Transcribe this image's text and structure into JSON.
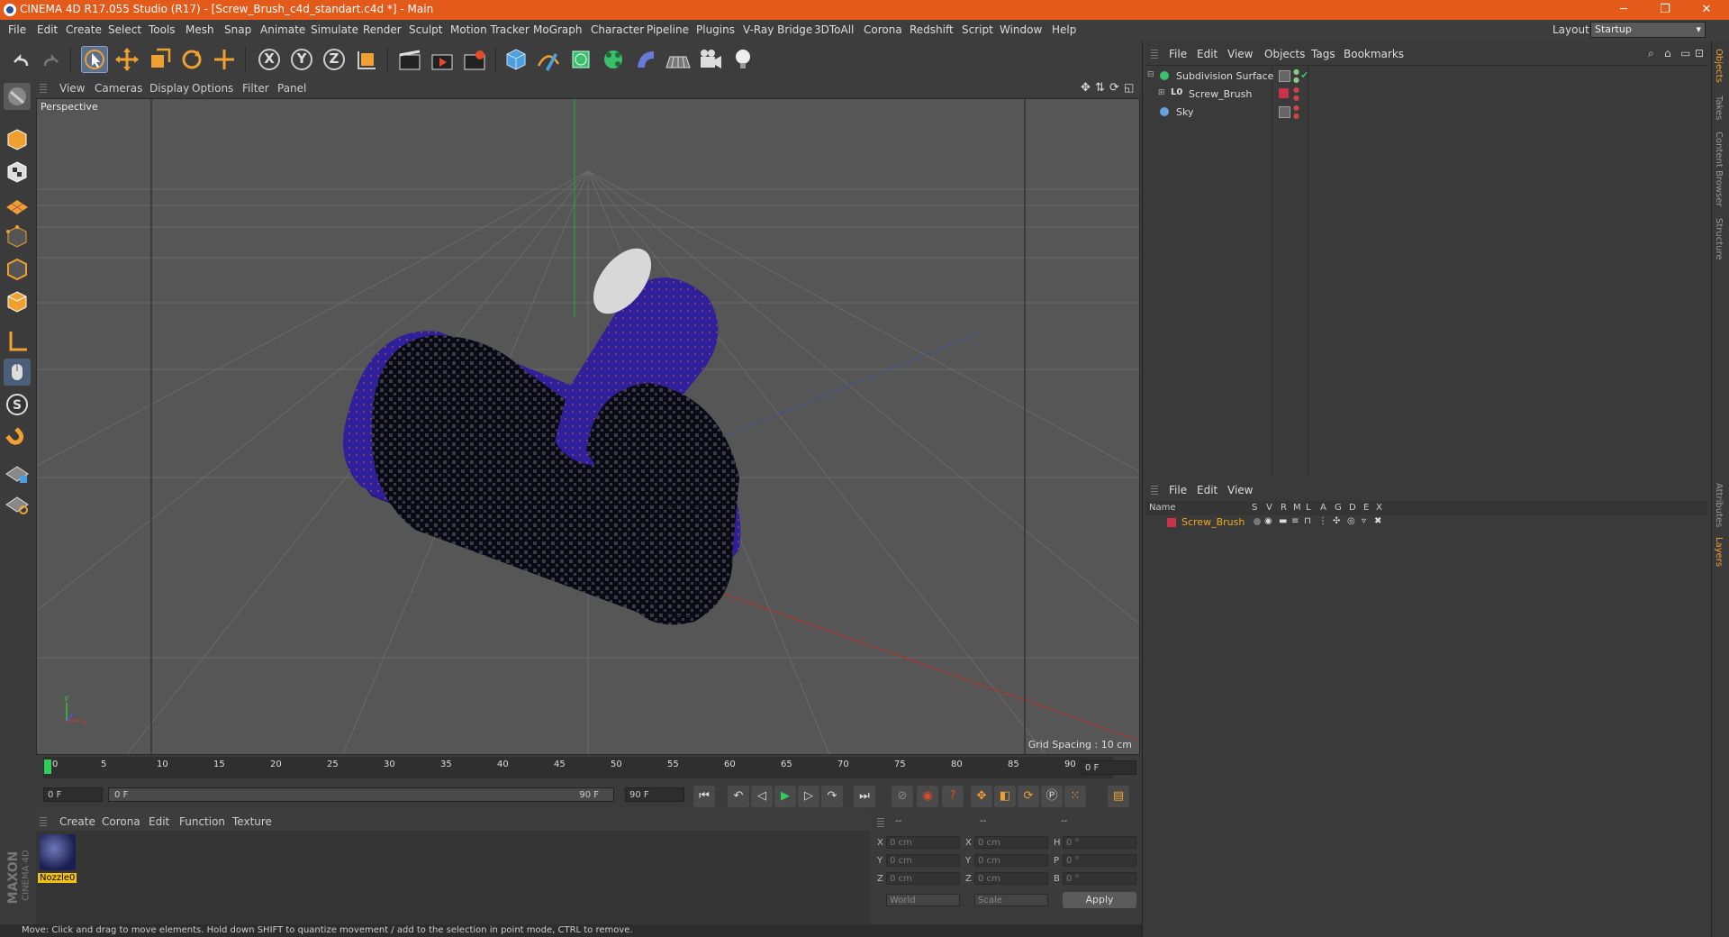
{
  "window": {
    "title": "CINEMA 4D R17.055 Studio (R17) - [Screw_Brush_c4d_standart.c4d *] - Main",
    "minimize": "─",
    "maximize": "❐",
    "close": "✕"
  },
  "menubar": {
    "items": [
      "File",
      "Edit",
      "Create",
      "Select",
      "Tools",
      "Mesh",
      "Snap",
      "Animate",
      "Simulate",
      "Render",
      "Sculpt",
      "Motion Tracker",
      "MoGraph",
      "Character",
      "Pipeline",
      "Plugins",
      "V-Ray Bridge",
      "3DToAll",
      "Corona",
      "Redshift",
      "Script",
      "Window",
      "Help"
    ],
    "layout_label": "Layout:",
    "layout_value": "Startup"
  },
  "toolbar": {
    "axis_x": "X",
    "axis_y": "Y",
    "axis_z": "Z"
  },
  "viewport": {
    "menu": [
      "View",
      "Cameras",
      "Display",
      "Options",
      "Filter",
      "Panel"
    ],
    "label": "Perspective",
    "grid_spacing": "Grid Spacing : 10 cm"
  },
  "timeline": {
    "ticks": [
      "0",
      "5",
      "10",
      "15",
      "20",
      "25",
      "30",
      "35",
      "40",
      "45",
      "50",
      "55",
      "60",
      "65",
      "70",
      "75",
      "80",
      "85",
      "90"
    ],
    "current_frame": "0 F",
    "start_field": "0 F",
    "range_start": "0 F",
    "range_end": "90 F",
    "end_field": "90 F"
  },
  "material_manager": {
    "menu": [
      "Create",
      "Corona",
      "Edit",
      "Function",
      "Texture"
    ],
    "material_name": "Nozzle0"
  },
  "coordinates": {
    "header": [
      "--",
      "--",
      "--"
    ],
    "rows": [
      {
        "l1": "X",
        "v1": "0 cm",
        "l2": "X",
        "v2": "0 cm",
        "l3": "H",
        "v3": "0 °"
      },
      {
        "l1": "Y",
        "v1": "0 cm",
        "l2": "Y",
        "v2": "0 cm",
        "l3": "P",
        "v3": "0 °"
      },
      {
        "l1": "Z",
        "v1": "0 cm",
        "l2": "Z",
        "v2": "0 cm",
        "l3": "B",
        "v3": "0 °"
      }
    ],
    "mode1": "World",
    "mode2": "Scale",
    "apply": "Apply"
  },
  "status_text": "Move: Click and drag to move elements. Hold down SHIFT to quantize movement / add to the selection in point mode, CTRL to remove.",
  "logo": {
    "line1": "MAXON",
    "line2": "CINEMA 4D"
  },
  "object_manager": {
    "menu": [
      "File",
      "Edit",
      "View",
      "Objects",
      "Tags",
      "Bookmarks"
    ],
    "objects": [
      {
        "name": "Subdivision Surface"
      },
      {
        "name": "Screw_Brush"
      },
      {
        "name": "Sky"
      }
    ]
  },
  "layer_manager": {
    "menu": [
      "File",
      "Edit",
      "View"
    ],
    "columns": [
      "Name",
      "S",
      "V",
      "R",
      "M",
      "L",
      "A",
      "G",
      "D",
      "E",
      "X"
    ],
    "layer_name": "Screw_Brush"
  },
  "side_tabs": [
    "Objects",
    "Takes",
    "Content Browser",
    "Structure",
    "Attributes",
    "Layers"
  ],
  "colors": {
    "title_bar": "#e35a1a",
    "layer_color": "#c8324a",
    "selected_text": "#f1a81a",
    "material_label_bg": "#f1c10f"
  }
}
